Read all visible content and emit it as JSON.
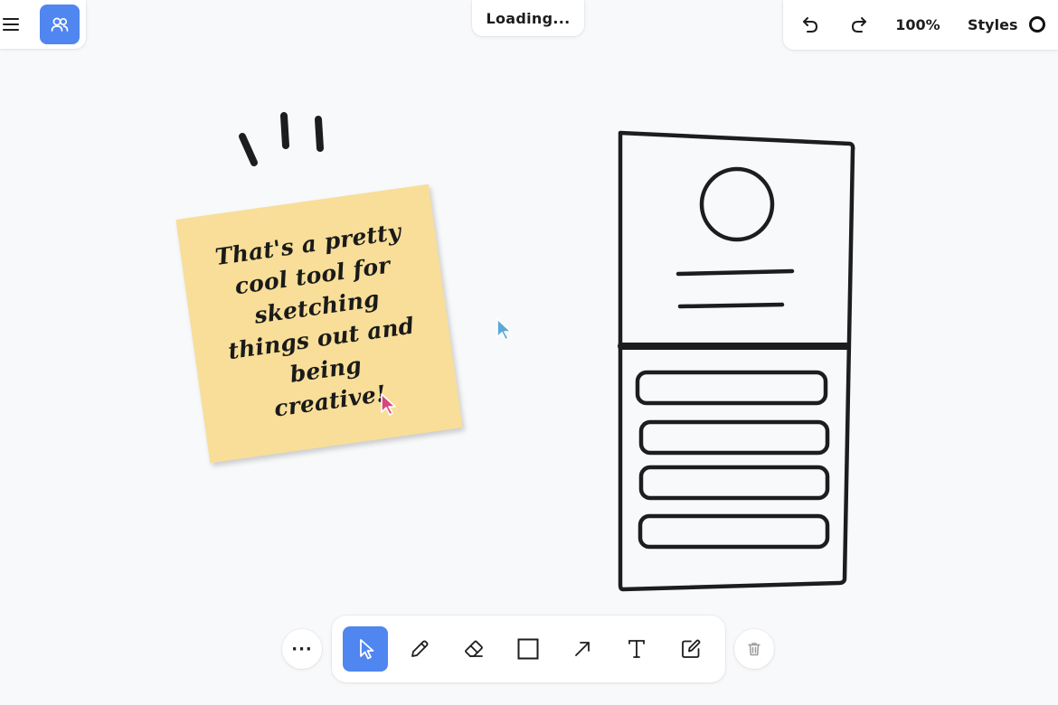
{
  "status": {
    "loading_text": "Loading..."
  },
  "header": {
    "zoom_label": "100%",
    "styles_label": "Styles"
  },
  "sticky_note": {
    "text": "That's a pretty cool tool for sketching things out and being creative!",
    "color": "#f8de98"
  },
  "colors": {
    "accent": "#4f86ef",
    "ink": "#1d1d1d",
    "background": "#f8f9fb",
    "cursor_pink": "#d9477d",
    "cursor_blue": "#5aa9d6"
  },
  "icons": {
    "menu": "hamburger-icon",
    "collaborators": "users-icon",
    "undo": "undo-icon",
    "redo": "redo-icon",
    "style_swatch": "circle-swatch-icon",
    "more": "ellipsis-icon",
    "delete": "trash-icon"
  },
  "toolbar": {
    "more_label": "···",
    "tools": [
      {
        "name": "select",
        "icon": "pointer-icon",
        "active": true
      },
      {
        "name": "draw",
        "icon": "pencil-icon",
        "active": false
      },
      {
        "name": "erase",
        "icon": "eraser-icon",
        "active": false
      },
      {
        "name": "rectangle",
        "icon": "square-icon",
        "active": false
      },
      {
        "name": "arrow",
        "icon": "arrow-icon",
        "active": false
      },
      {
        "name": "text",
        "icon": "text-icon",
        "active": false
      },
      {
        "name": "note",
        "icon": "note-edit-icon",
        "active": false
      }
    ]
  }
}
